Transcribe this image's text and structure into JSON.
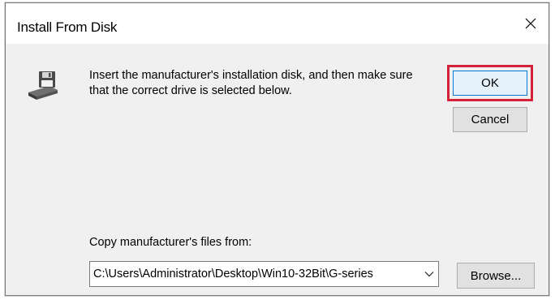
{
  "dialog": {
    "title": "Install From Disk",
    "close_icon": "close-icon",
    "message": "Insert the manufacturer's installation disk, and then make sure that the correct drive is selected below.",
    "icon": "floppy-disk-drive-icon",
    "buttons": {
      "ok_label": "OK",
      "cancel_label": "Cancel",
      "browse_label": "Browse..."
    },
    "copy_from": {
      "label": "Copy manufacturer's files from:",
      "value": "C:\\Users\\Administrator\\Desktop\\Win10-32Bit\\G-series",
      "dropdown_icon": "chevron-down-icon"
    },
    "highlight_color": "#d3223a"
  }
}
